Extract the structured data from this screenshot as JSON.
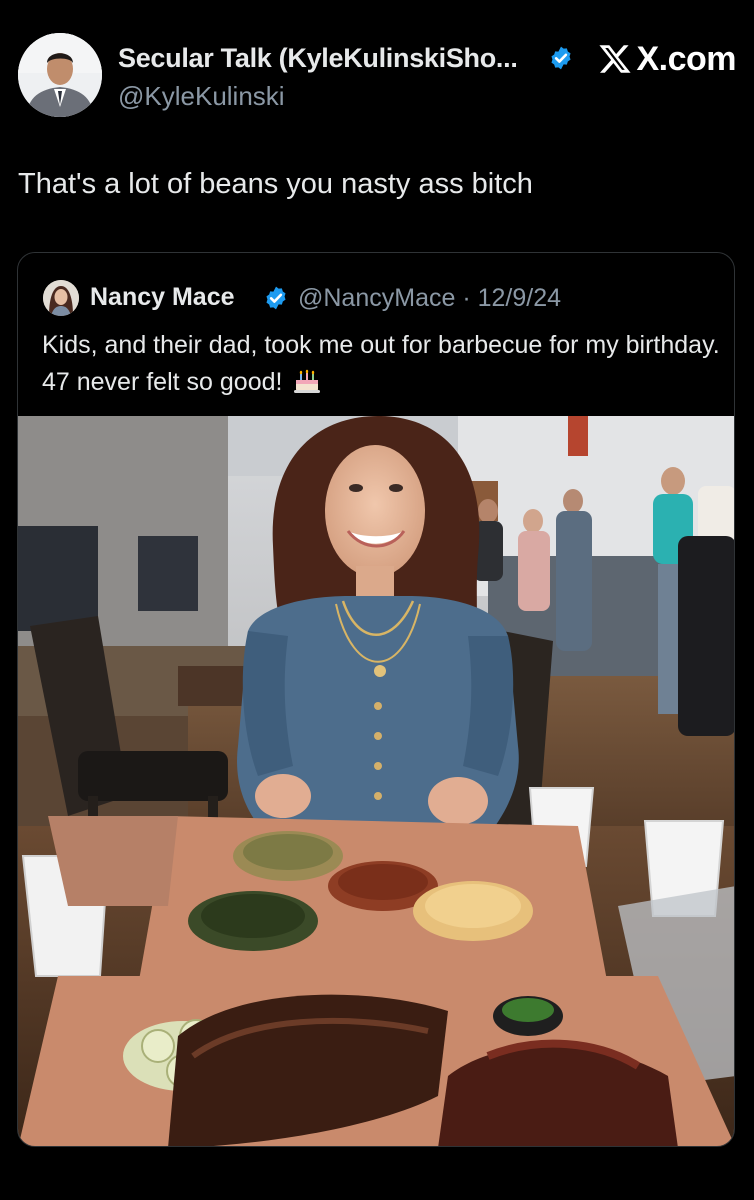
{
  "author": {
    "name": "Secular Talk (KyleKulinskiSho...",
    "handle": "@KyleKulinski",
    "verified": true
  },
  "brand": {
    "label": "X.com"
  },
  "tweet": {
    "text": "That's a lot of beans you nasty ass bitch"
  },
  "quoted_tweet": {
    "author_name": "Nancy Mace",
    "handle": "@NancyMace",
    "separator": "·",
    "date": "12/9/24",
    "text": "Kids, and their dad, took me out for barbecue for my birthday. 47 never felt so good!",
    "emoji": "birthday-cake-icon"
  },
  "colors": {
    "background": "#000000",
    "text": "#e7e9ea",
    "muted": "#8b98a5",
    "verified": "#1d9bf0",
    "border": "#2f3336"
  }
}
